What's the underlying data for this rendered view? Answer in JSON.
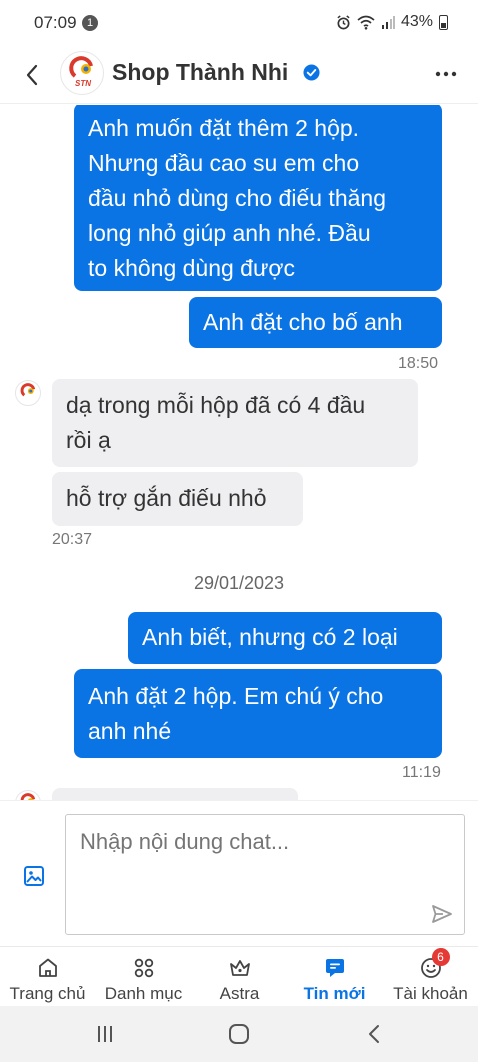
{
  "status_bar": {
    "time": "07:09",
    "notification_count": "1",
    "battery": "43%"
  },
  "header": {
    "shop_name": "Shop Thành Nhi",
    "logo_text": "STN"
  },
  "chat": {
    "messages_top": [
      {
        "text": "Anh muốn đặt thêm 2 hộp.\nNhưng đầu cao su em cho\nđầu nhỏ dùng cho điếu thăng\nlong nhỏ giúp anh nhé. Đầu\nto không dùng được"
      },
      {
        "text": "Anh đặt cho bố anh"
      }
    ],
    "time_1": "18:50",
    "messages_in": [
      {
        "text": "dạ trong mỗi hộp đã có 4 đầu\nrồi ạ"
      },
      {
        "text": "hỗ trợ gắn điếu nhỏ"
      }
    ],
    "time_2": "20:37",
    "date_separator": "29/01/2023",
    "messages_bottom": [
      {
        "text": "Anh biết, nhưng có 2 loại"
      },
      {
        "text": "Anh đặt 2 hộp. Em chú ý cho\nanh nhé"
      }
    ],
    "time_3": "11:19"
  },
  "composer": {
    "placeholder": "Nhập nội dung chat..."
  },
  "bottom_nav": {
    "items": [
      {
        "label": "Trang chủ",
        "icon": "home-icon"
      },
      {
        "label": "Danh mục",
        "icon": "grid-icon"
      },
      {
        "label": "Astra",
        "icon": "crown-icon"
      },
      {
        "label": "Tin mới",
        "icon": "chat-icon"
      },
      {
        "label": "Tài khoản",
        "icon": "smile-icon",
        "badge": "6"
      }
    ]
  },
  "colors": {
    "accent": "#0b74e5",
    "incoming_bubble": "#efeff1",
    "badge": "#e53935"
  }
}
